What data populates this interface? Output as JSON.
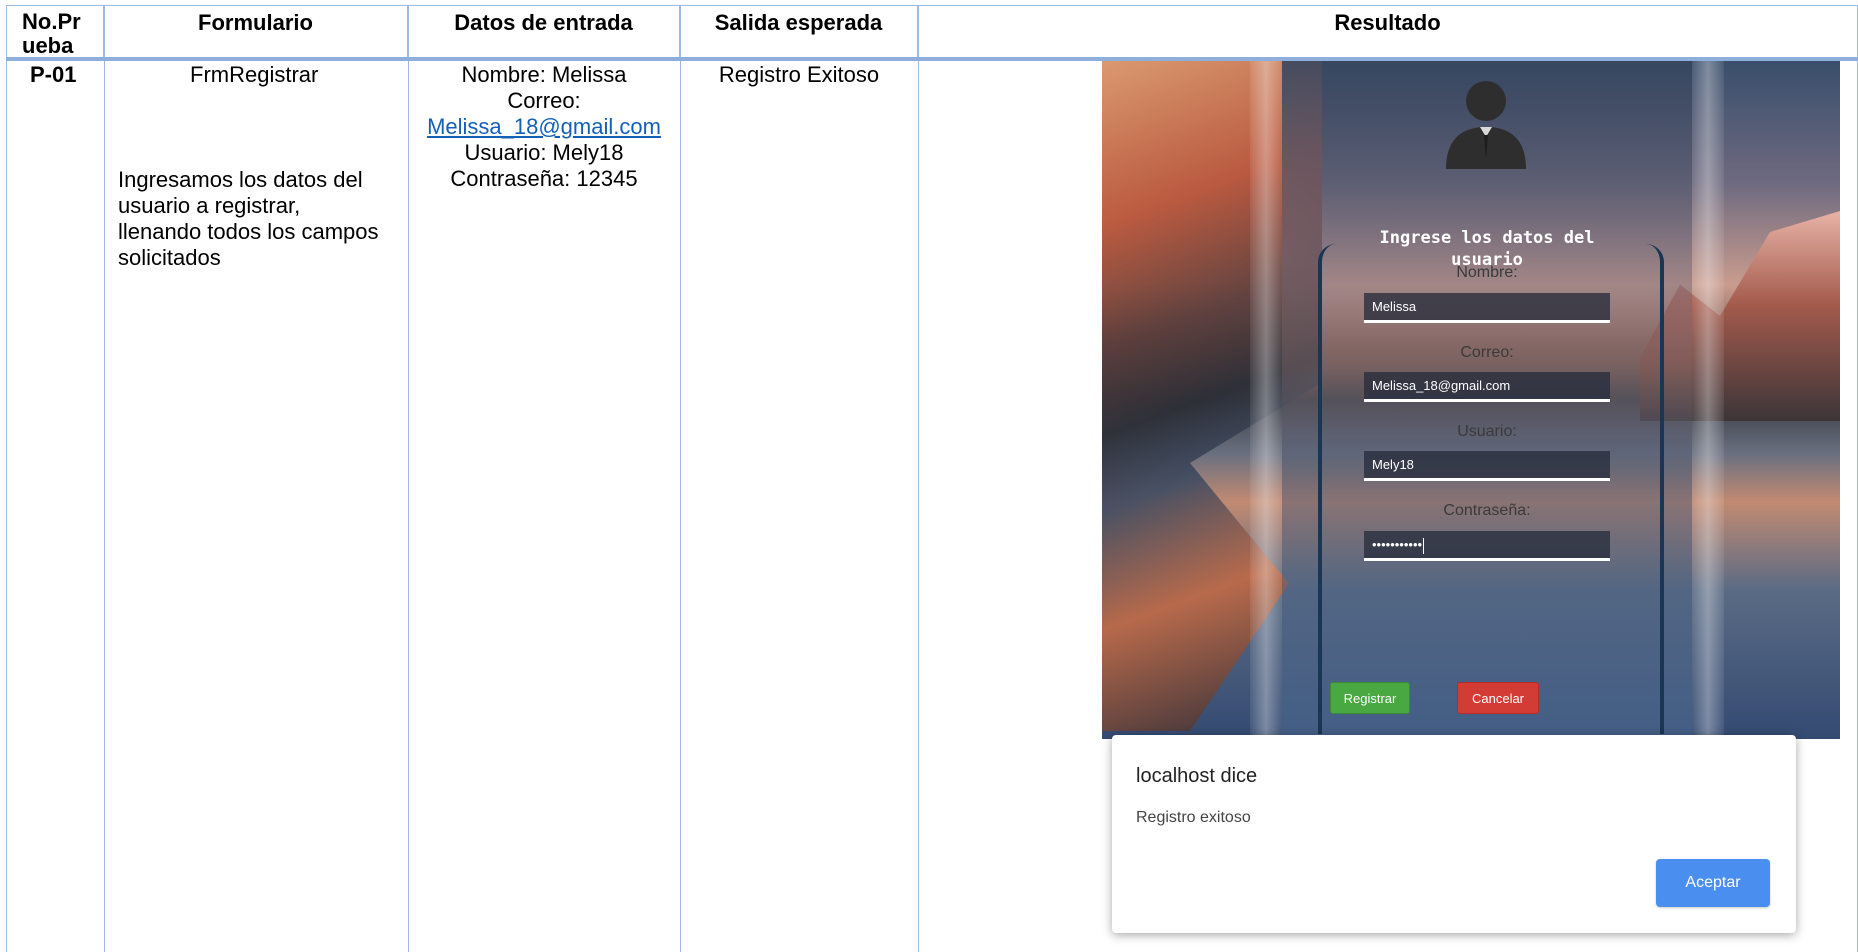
{
  "table": {
    "headers": {
      "no_prueba": "No.Prueba",
      "formulario": "Formulario",
      "datos_entrada": "Datos de entrada",
      "salida_esperada": "Salida esperada",
      "resultado": "Resultado"
    },
    "row": {
      "id": "P-01",
      "form_name": "FrmRegistrar",
      "description_lines": [
        "Ingresamos los datos del",
        "usuario a registrar,",
        "llenando todos los campos",
        "solicitados"
      ],
      "input_nombre": "Nombre: Melissa",
      "input_correo_label": "Correo:",
      "input_correo_value": "Melissa_18@gmail.com",
      "input_usuario": "Usuario: Mely18",
      "input_contrasena": "Contraseña: 12345",
      "expected_output": "Registro Exitoso"
    }
  },
  "screenshot": {
    "form_title_lines": [
      "Ingrese los datos del",
      "usuario"
    ],
    "labels": {
      "nombre": "Nombre:",
      "correo": "Correo:",
      "usuario": "Usuario:",
      "contrasena": "Contraseña:"
    },
    "values": {
      "nombre": "Melissa",
      "correo": "Melissa_18@gmail.com",
      "usuario": "Mely18",
      "contrasena_masked": "•••••••••••"
    },
    "buttons": {
      "registrar": "Registrar",
      "cancelar": "Cancelar"
    },
    "colors": {
      "registrar": "#4aa842",
      "cancelar": "#d33b35"
    }
  },
  "dialog": {
    "title": "localhost dice",
    "message": "Registro exitoso",
    "button": "Aceptar",
    "button_color": "#4a8ef0"
  }
}
